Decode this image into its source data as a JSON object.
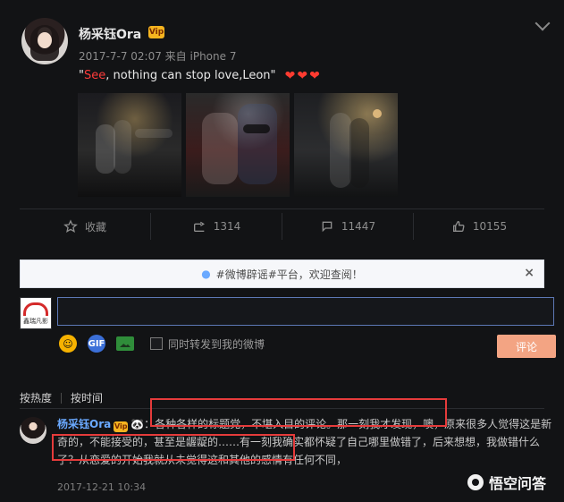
{
  "post": {
    "username": "杨采钰Ora",
    "vip_badge": "Vip",
    "meta": "2017-7-7 02:07 来自 iPhone 7",
    "text_prefix": "\"",
    "text_highlight": "See",
    "text_rest": ", nothing can stop love,Leon\"",
    "hearts": "❤❤❤"
  },
  "actions": {
    "favorite_label": "收藏",
    "repost_count": "1314",
    "comment_count": "11447",
    "like_count": "10155"
  },
  "notice": {
    "text": "#微博辟谣#平台，欢迎查阅！",
    "close": "×"
  },
  "composer": {
    "avatar_caption": "鑫瑞凡影",
    "input_value": "",
    "input_placeholder": "",
    "checkbox_label": "同时转发到我的微博",
    "submit_label": "评论"
  },
  "sort": {
    "by_hot": "按热度",
    "by_time": "按时间"
  },
  "comment": {
    "name": "杨采钰Ora",
    "badge": "Vip",
    "panda": "🐼",
    "text": "：各种各样的标题党，不堪入目的评论。那一刻我才发现，噢，原来很多人觉得这是新奇的，不能接受的，甚至是龌龊的……有一刻我确实都怀疑了自己哪里做错了，后来想想，我做错什么了？从恋爱的开始我就从未觉得这和其他的感情有任何不同，",
    "time": "2017-12-21 10:34"
  },
  "watermark": {
    "text": "悟空问答"
  },
  "colors": {
    "highlight_red": "#ff3b3b",
    "link_blue": "#6aa9ff",
    "submit_orange": "#f3a483",
    "box_red": "#e53b3b"
  },
  "icons": {
    "favorite": "star-icon",
    "repost": "share-icon",
    "comment": "comment-icon",
    "like": "thumb-up-icon",
    "notice": "lightbulb-icon"
  }
}
